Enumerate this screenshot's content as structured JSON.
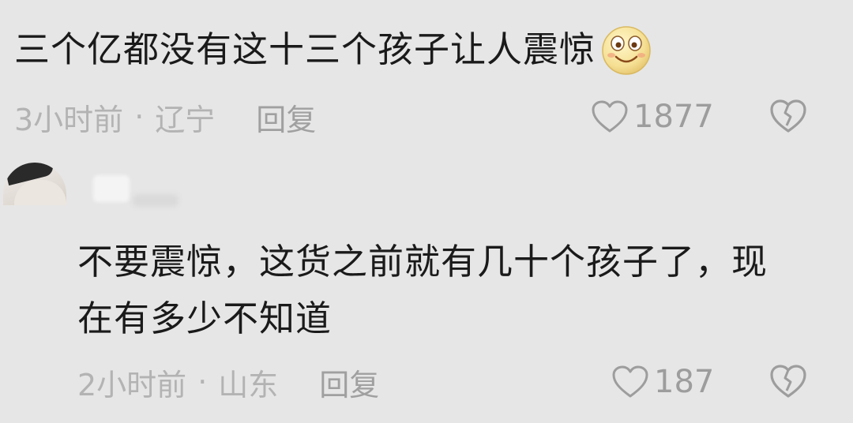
{
  "comments": [
    {
      "text": "三个亿都没有这十三个孩子让人震惊",
      "emoji": "smiling-face-emoji",
      "time": "3小时前",
      "separator": "·",
      "location": "辽宁",
      "reply_label": "回复",
      "like_count": "1877"
    },
    {
      "text": "不要震惊，这货之前就有几十个孩子了，现在有多少不知道",
      "time": "2小时前",
      "separator": "·",
      "location": "山东",
      "reply_label": "回复",
      "like_count": "187"
    }
  ],
  "colors": {
    "background": "#e6e6e6",
    "text": "#1a1a1a",
    "meta": "#b3b3b3",
    "icon": "#9d9d9d"
  }
}
